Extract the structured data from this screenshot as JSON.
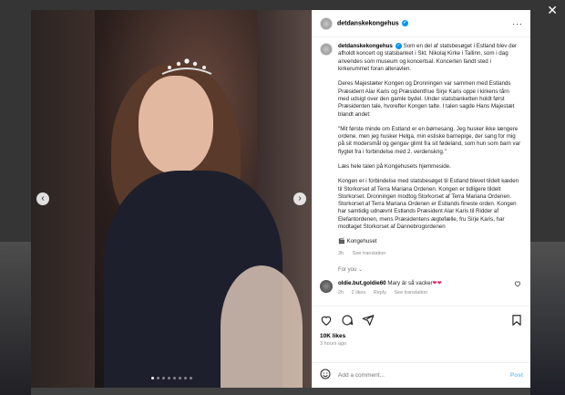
{
  "page": {
    "close_symbol": "✕"
  },
  "post": {
    "username": "detdanskekongehus",
    "more_symbol": "···",
    "caption": {
      "username": "detdanskekongehus",
      "paragraphs": [
        "Som en del af statsbesøget i Estland blev der afholdt koncert og statsbanket i Skt. Nikolaj Kirke i Tallinn, som i dag anvendes som museum og koncertsal. Koncerten fandt sted i kirkerummet foran alteravlen.",
        "Deres Majestæter Kongen og Dronningen var sammen med Estlands Præsident Alar Karis og Præsidentfrue Sirje Karis oppe i kirkens tårn med udsigt over den gamle bydel. Under statsbanketten holdt først Præsidenten tale, hvorefter Kongen talte. I talen sagde Hans Majestæt blandt andet:",
        "\"Mit første minde om Estland er en børnesang. Jeg husker ikke længere ordene, men jeg husker Helga, min estiske barnepige, der sang for mig på sit modersmål og gengav glimt fra sit fødeland, som hun som barn var flygtet fra i forbindelse med 2. verdenskrig.\"",
        "Læs hele talen på Kongehusets hjemmeside.",
        "Kongen er i forbindelse med statsbesøget til Estland blevet tildelt kæden til Storkorset af Terra Mariana Ordenen. Kongen er tidligere tildelt Storkorset. Dronningen modtog Storkorset af Terra Mariana Ordenen. Storkorset af Terra Mariana Ordenen er Estlands fineste orden. Kongen har samtidig udnævnt Estlands Præsident Alar Karis til Ridder af Elefantordenen, mens Præsidentens ægtefælle, fru Sirje Karis, har modtaget Storkorset af Dannebrogordenen"
      ],
      "signature_icon": "🎬",
      "signature": "Kongehuset",
      "time": "3h",
      "see_translation": "See translation"
    },
    "for_you_label": "For you",
    "chevron": "⌄",
    "comment": {
      "username": "oldie.but.goldie60",
      "text": "Mary är så vacker",
      "hearts": "❤❤",
      "time": "2h",
      "likes": "2 likes",
      "reply": "Reply",
      "see_translation": "See translation"
    },
    "likes": "10K likes",
    "posted": "3 hours ago",
    "add_comment_placeholder": "Add a comment...",
    "post_label": "Post",
    "carousel": {
      "slides": 8,
      "active_index": 0
    }
  },
  "colors": {
    "accent": "#0095f6",
    "post_button": "#7ec3f7",
    "heart": "#e0245e"
  },
  "icons": [
    "heart-icon",
    "comment-icon",
    "share-icon",
    "bookmark-icon",
    "emoji-icon",
    "verified-icon",
    "more-icon",
    "close-icon",
    "chevron-left-icon",
    "chevron-right-icon"
  ]
}
